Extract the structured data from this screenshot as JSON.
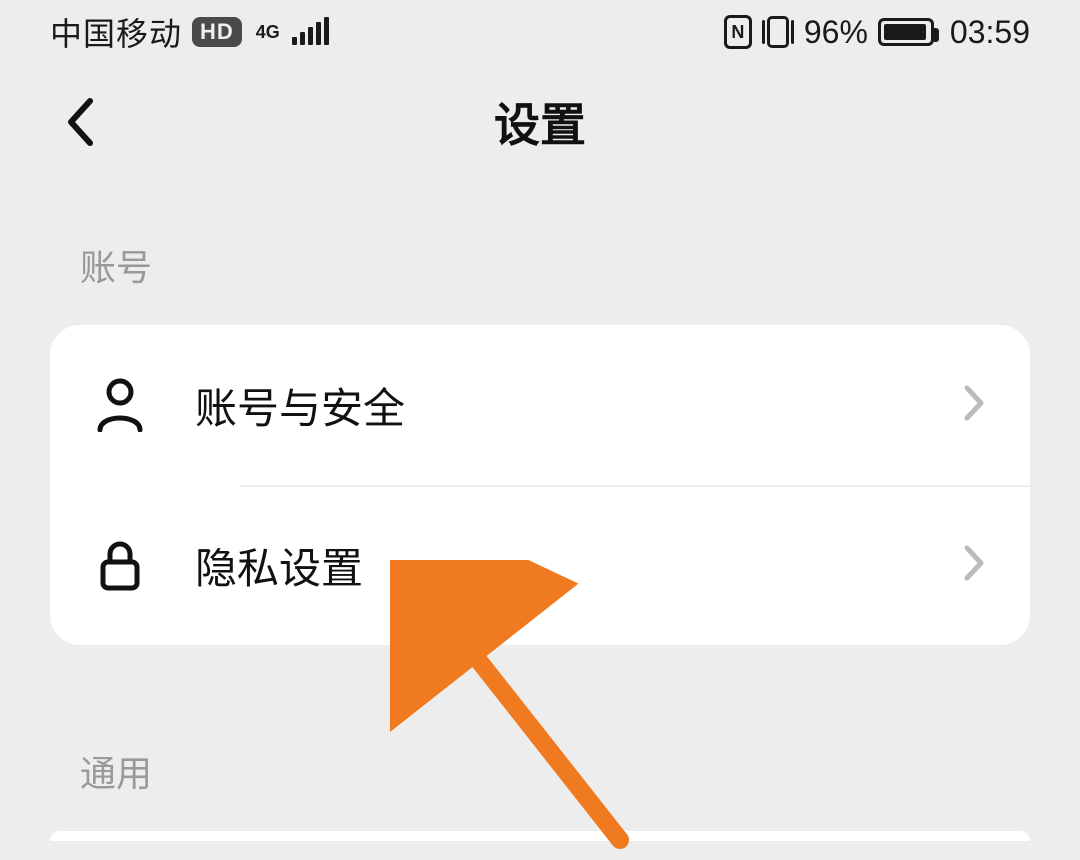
{
  "status": {
    "carrier": "中国移动",
    "hd_badge": "HD",
    "net_label": "4G",
    "battery_percent": "96%",
    "battery_fill_pct": 96,
    "time": "03:59"
  },
  "nav": {
    "title": "设置"
  },
  "sections": {
    "account": {
      "header": "账号",
      "rows": [
        {
          "label": "账号与安全"
        },
        {
          "label": "隐私设置"
        }
      ]
    },
    "general": {
      "header": "通用"
    }
  }
}
